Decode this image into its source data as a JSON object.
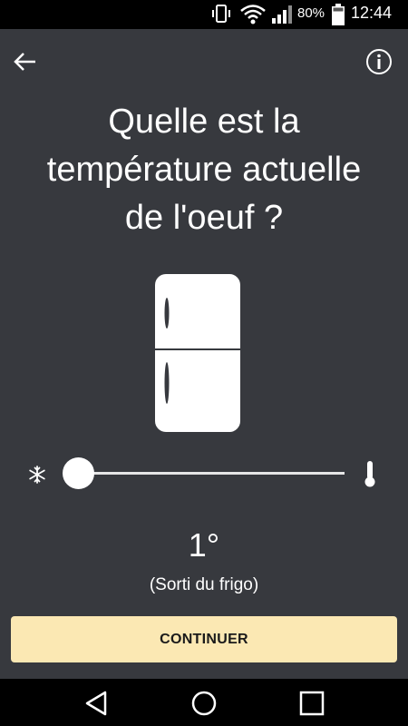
{
  "status_bar": {
    "battery_percent": "80%",
    "time": "12:44",
    "icons": [
      "vibrate-icon",
      "wifi-icon",
      "signal-icon",
      "battery-icon"
    ]
  },
  "top_bar": {
    "back_icon": "arrow-left-icon",
    "info_icon": "info-icon"
  },
  "question": {
    "lines": [
      "Quelle est la",
      "température actuelle",
      "de l'oeuf ?"
    ]
  },
  "illustration": "fridge-icon",
  "slider": {
    "min_icon": "snowflake-icon",
    "max_icon": "thermometer-icon",
    "level": 0.0
  },
  "temperature": {
    "value": "1°",
    "caption": "(Sorti du frigo)"
  },
  "continue_button": {
    "label": "CONTINUER"
  },
  "nav_bar": {
    "icons": [
      "back-triangle-icon",
      "home-circle-icon",
      "recents-square-icon"
    ]
  },
  "colors": {
    "background": "#37393e",
    "button": "#fbe8b3",
    "bars": "#000000"
  }
}
